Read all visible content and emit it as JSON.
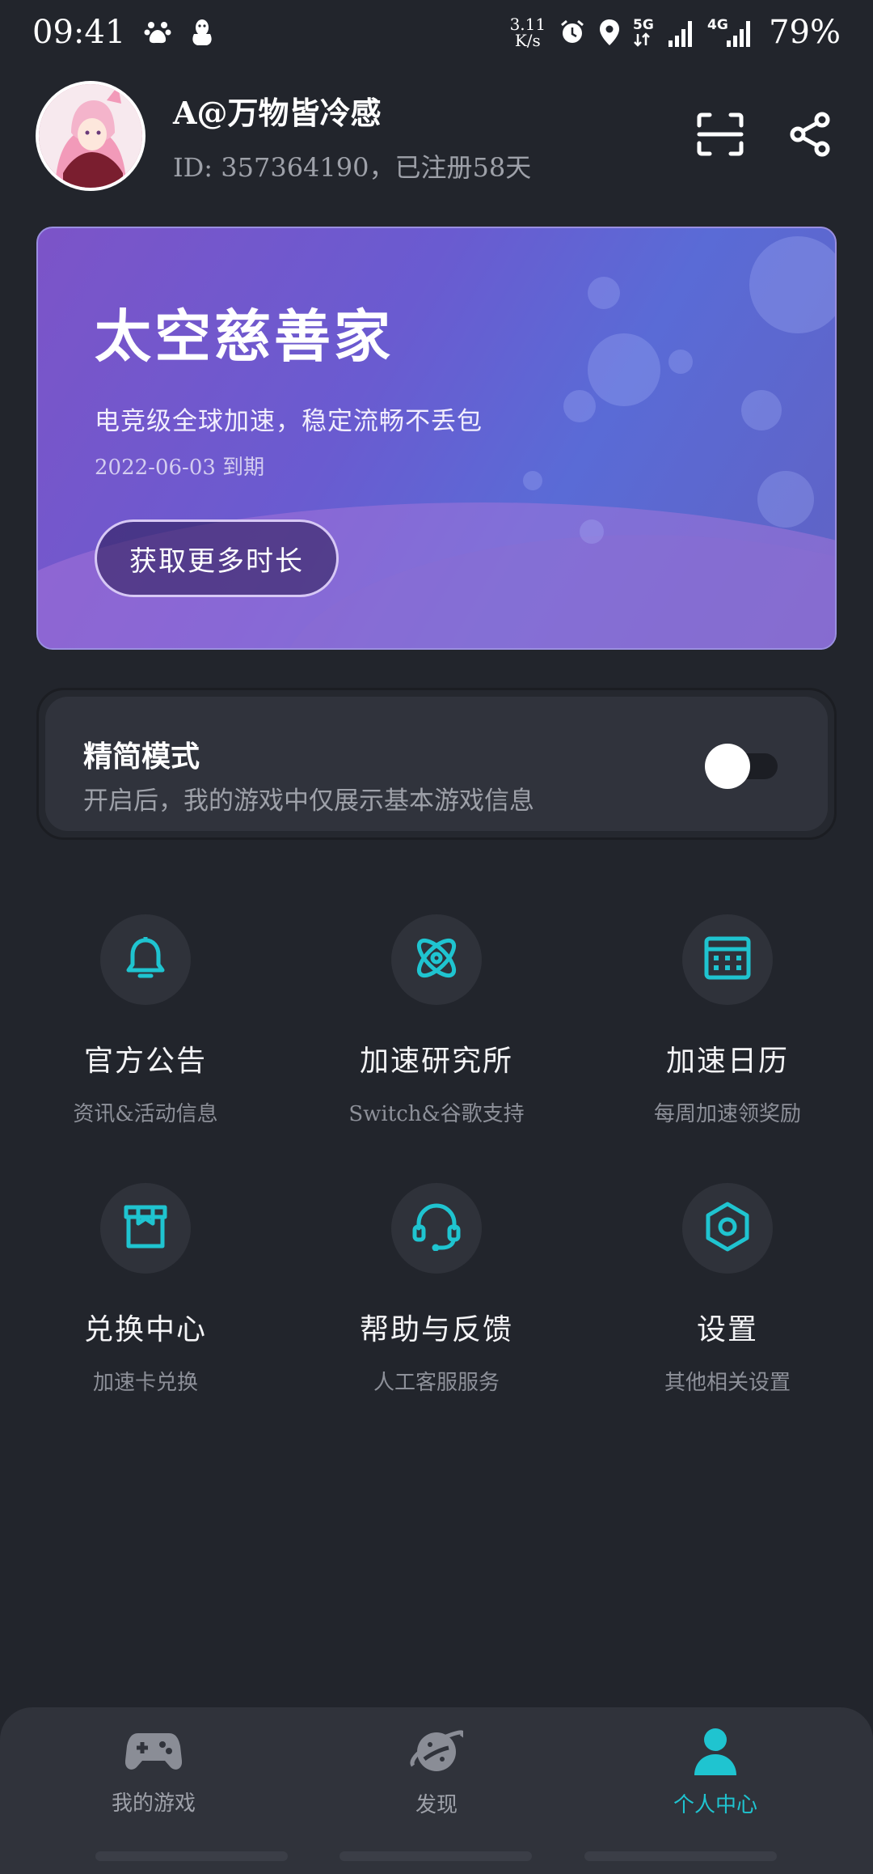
{
  "status_bar": {
    "time": "09:41",
    "net_speed_value": "3.11",
    "net_speed_unit": "K/s",
    "network_5g": "5G",
    "network_4g": "4G",
    "battery": "79%"
  },
  "profile": {
    "name": "A@万物皆冷感",
    "sub": "ID: 357364190，已注册58天"
  },
  "vip_card": {
    "title": "太空慈善家",
    "description": "电竞级全球加速，稳定流畅不丢包",
    "expire": "2022-06-03 到期",
    "button_label": "获取更多时长"
  },
  "simple_mode": {
    "title": "精简模式",
    "description": "开启后，我的游戏中仅展示基本游戏信息",
    "enabled": true
  },
  "menu": [
    {
      "title": "官方公告",
      "sub": "资讯&活动信息",
      "icon": "bell-icon"
    },
    {
      "title": "加速研究所",
      "sub": "Switch&谷歌支持",
      "icon": "atom-icon"
    },
    {
      "title": "加速日历",
      "sub": "每周加速领奖励",
      "icon": "calendar-icon"
    },
    {
      "title": "兑换中心",
      "sub": "加速卡兑换",
      "icon": "gift-box-icon"
    },
    {
      "title": "帮助与反馈",
      "sub": "人工客服服务",
      "icon": "headset-icon"
    },
    {
      "title": "设置",
      "sub": "其他相关设置",
      "icon": "settings-icon"
    }
  ],
  "tabs": [
    {
      "label": "我的游戏",
      "icon": "gamepad-icon",
      "active": false
    },
    {
      "label": "发现",
      "icon": "planet-icon",
      "active": false
    },
    {
      "label": "个人中心",
      "icon": "user-icon",
      "active": true
    }
  ],
  "colors": {
    "background": "#22252c",
    "accent": "#1fc4d0",
    "card_purple": "#6a5bd0",
    "muted_text": "#9ea1a9"
  }
}
